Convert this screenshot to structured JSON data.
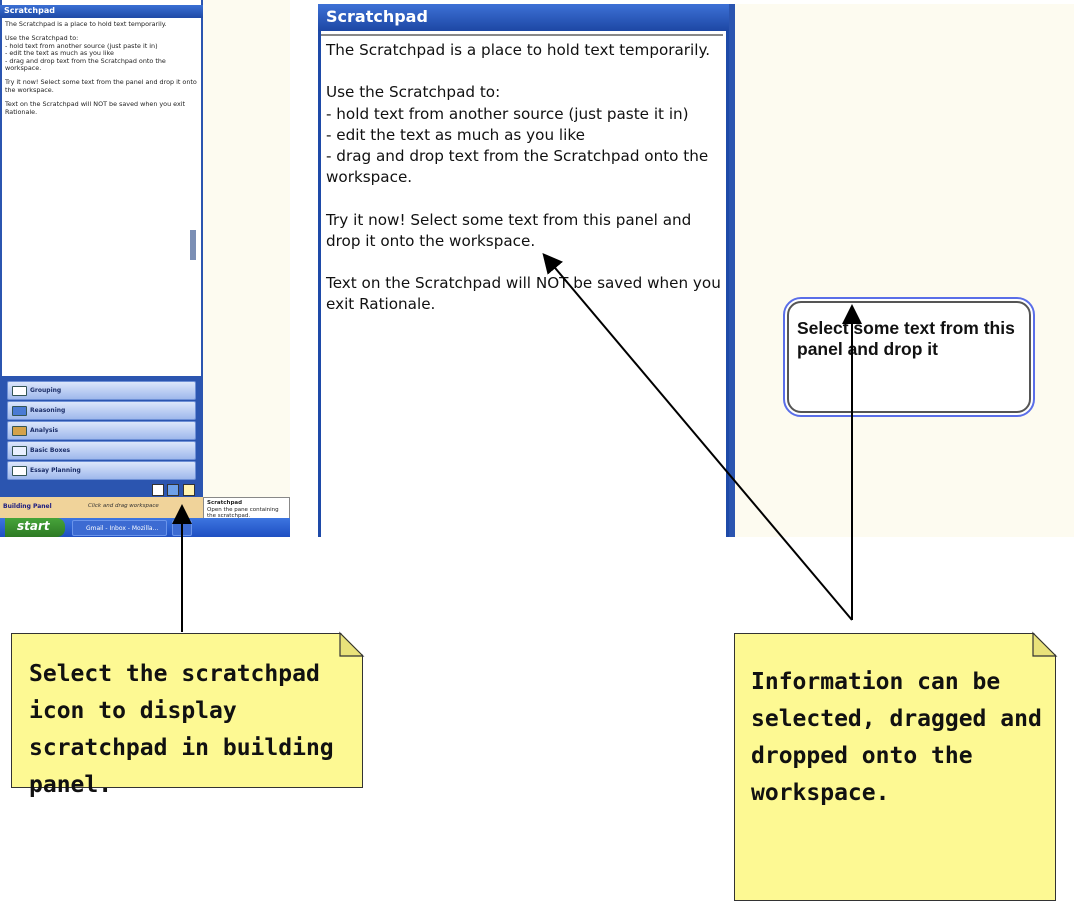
{
  "small_screenshot": {
    "scratchpad_title": "Scratchpad",
    "scratchpad_paragraphs": [
      "The Scratchpad is a place to hold text temporarily.",
      "Use the Scratchpad to:\n- hold text from another source (just paste it in)\n- edit the text as much as you like\n- drag and drop text from the Scratchpad onto the workspace.",
      "Try it now! Select some text from the panel and drop it onto the workspace.",
      "Text on the Scratchpad will NOT be saved when you exit Rationale."
    ],
    "panel_buttons": [
      {
        "label": "Grouping",
        "icon": "grouping-icon"
      },
      {
        "label": "Reasoning",
        "icon": "reasoning-icon"
      },
      {
        "label": "Analysis",
        "icon": "analysis-icon"
      },
      {
        "label": "Basic Boxes",
        "icon": "basic-boxes-icon"
      },
      {
        "label": "Essay Planning",
        "icon": "essay-planning-icon"
      }
    ],
    "building_panel_label": "Building Panel",
    "building_panel_hint": "Click and drag workspace",
    "tooltip_title": "Scratchpad",
    "tooltip_text": "Open the pane containing the scratchpad.",
    "start_label": "start",
    "taskbar_item": "Gmail - Inbox - Mozilla..."
  },
  "large_screenshot": {
    "scratchpad_title": "Scratchpad",
    "paragraphs": [
      "The Scratchpad is a place to hold text temporarily.",
      "Use the Scratchpad to:\n- hold text from another source (just paste it in)\n- edit the text as much as you like\n- drag and drop text from the Scratchpad onto the workspace.",
      "Try it now!  Select some text from this panel and drop it onto the workspace.",
      "Text on the Scratchpad will NOT be saved when you exit Rationale."
    ],
    "workspace_node_text": "Select some text from this panel and drop it"
  },
  "notes": {
    "left": "Select the scratchpad icon to display scratchpad in building panel.",
    "right": "Information can be selected, dragged and dropped onto the workspace."
  },
  "colors": {
    "panel_blue": "#2b55b0",
    "note_yellow": "#fdf993",
    "workspace_cream": "#fdfbf0",
    "node_border": "#5a6ee8"
  }
}
